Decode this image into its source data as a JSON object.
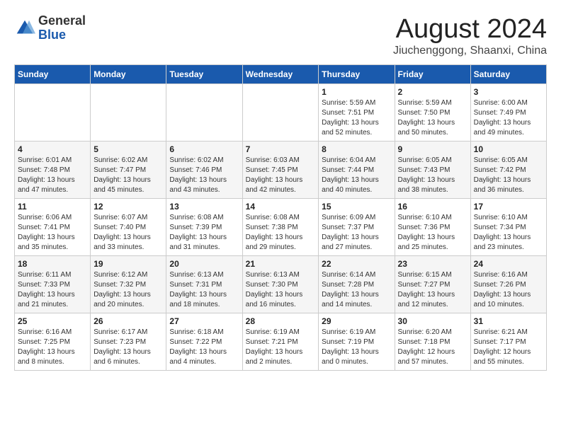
{
  "header": {
    "logo_general": "General",
    "logo_blue": "Blue",
    "main_title": "August 2024",
    "subtitle": "Jiuchenggong, Shaanxi, China"
  },
  "calendar": {
    "days_of_week": [
      "Sunday",
      "Monday",
      "Tuesday",
      "Wednesday",
      "Thursday",
      "Friday",
      "Saturday"
    ],
    "weeks": [
      [
        {
          "day": "",
          "info": ""
        },
        {
          "day": "",
          "info": ""
        },
        {
          "day": "",
          "info": ""
        },
        {
          "day": "",
          "info": ""
        },
        {
          "day": "1",
          "info": "Sunrise: 5:59 AM\nSunset: 7:51 PM\nDaylight: 13 hours\nand 52 minutes."
        },
        {
          "day": "2",
          "info": "Sunrise: 5:59 AM\nSunset: 7:50 PM\nDaylight: 13 hours\nand 50 minutes."
        },
        {
          "day": "3",
          "info": "Sunrise: 6:00 AM\nSunset: 7:49 PM\nDaylight: 13 hours\nand 49 minutes."
        }
      ],
      [
        {
          "day": "4",
          "info": "Sunrise: 6:01 AM\nSunset: 7:48 PM\nDaylight: 13 hours\nand 47 minutes."
        },
        {
          "day": "5",
          "info": "Sunrise: 6:02 AM\nSunset: 7:47 PM\nDaylight: 13 hours\nand 45 minutes."
        },
        {
          "day": "6",
          "info": "Sunrise: 6:02 AM\nSunset: 7:46 PM\nDaylight: 13 hours\nand 43 minutes."
        },
        {
          "day": "7",
          "info": "Sunrise: 6:03 AM\nSunset: 7:45 PM\nDaylight: 13 hours\nand 42 minutes."
        },
        {
          "day": "8",
          "info": "Sunrise: 6:04 AM\nSunset: 7:44 PM\nDaylight: 13 hours\nand 40 minutes."
        },
        {
          "day": "9",
          "info": "Sunrise: 6:05 AM\nSunset: 7:43 PM\nDaylight: 13 hours\nand 38 minutes."
        },
        {
          "day": "10",
          "info": "Sunrise: 6:05 AM\nSunset: 7:42 PM\nDaylight: 13 hours\nand 36 minutes."
        }
      ],
      [
        {
          "day": "11",
          "info": "Sunrise: 6:06 AM\nSunset: 7:41 PM\nDaylight: 13 hours\nand 35 minutes."
        },
        {
          "day": "12",
          "info": "Sunrise: 6:07 AM\nSunset: 7:40 PM\nDaylight: 13 hours\nand 33 minutes."
        },
        {
          "day": "13",
          "info": "Sunrise: 6:08 AM\nSunset: 7:39 PM\nDaylight: 13 hours\nand 31 minutes."
        },
        {
          "day": "14",
          "info": "Sunrise: 6:08 AM\nSunset: 7:38 PM\nDaylight: 13 hours\nand 29 minutes."
        },
        {
          "day": "15",
          "info": "Sunrise: 6:09 AM\nSunset: 7:37 PM\nDaylight: 13 hours\nand 27 minutes."
        },
        {
          "day": "16",
          "info": "Sunrise: 6:10 AM\nSunset: 7:36 PM\nDaylight: 13 hours\nand 25 minutes."
        },
        {
          "day": "17",
          "info": "Sunrise: 6:10 AM\nSunset: 7:34 PM\nDaylight: 13 hours\nand 23 minutes."
        }
      ],
      [
        {
          "day": "18",
          "info": "Sunrise: 6:11 AM\nSunset: 7:33 PM\nDaylight: 13 hours\nand 21 minutes."
        },
        {
          "day": "19",
          "info": "Sunrise: 6:12 AM\nSunset: 7:32 PM\nDaylight: 13 hours\nand 20 minutes."
        },
        {
          "day": "20",
          "info": "Sunrise: 6:13 AM\nSunset: 7:31 PM\nDaylight: 13 hours\nand 18 minutes."
        },
        {
          "day": "21",
          "info": "Sunrise: 6:13 AM\nSunset: 7:30 PM\nDaylight: 13 hours\nand 16 minutes."
        },
        {
          "day": "22",
          "info": "Sunrise: 6:14 AM\nSunset: 7:28 PM\nDaylight: 13 hours\nand 14 minutes."
        },
        {
          "day": "23",
          "info": "Sunrise: 6:15 AM\nSunset: 7:27 PM\nDaylight: 13 hours\nand 12 minutes."
        },
        {
          "day": "24",
          "info": "Sunrise: 6:16 AM\nSunset: 7:26 PM\nDaylight: 13 hours\nand 10 minutes."
        }
      ],
      [
        {
          "day": "25",
          "info": "Sunrise: 6:16 AM\nSunset: 7:25 PM\nDaylight: 13 hours\nand 8 minutes."
        },
        {
          "day": "26",
          "info": "Sunrise: 6:17 AM\nSunset: 7:23 PM\nDaylight: 13 hours\nand 6 minutes."
        },
        {
          "day": "27",
          "info": "Sunrise: 6:18 AM\nSunset: 7:22 PM\nDaylight: 13 hours\nand 4 minutes."
        },
        {
          "day": "28",
          "info": "Sunrise: 6:19 AM\nSunset: 7:21 PM\nDaylight: 13 hours\nand 2 minutes."
        },
        {
          "day": "29",
          "info": "Sunrise: 6:19 AM\nSunset: 7:19 PM\nDaylight: 13 hours\nand 0 minutes."
        },
        {
          "day": "30",
          "info": "Sunrise: 6:20 AM\nSunset: 7:18 PM\nDaylight: 12 hours\nand 57 minutes."
        },
        {
          "day": "31",
          "info": "Sunrise: 6:21 AM\nSunset: 7:17 PM\nDaylight: 12 hours\nand 55 minutes."
        }
      ]
    ]
  }
}
